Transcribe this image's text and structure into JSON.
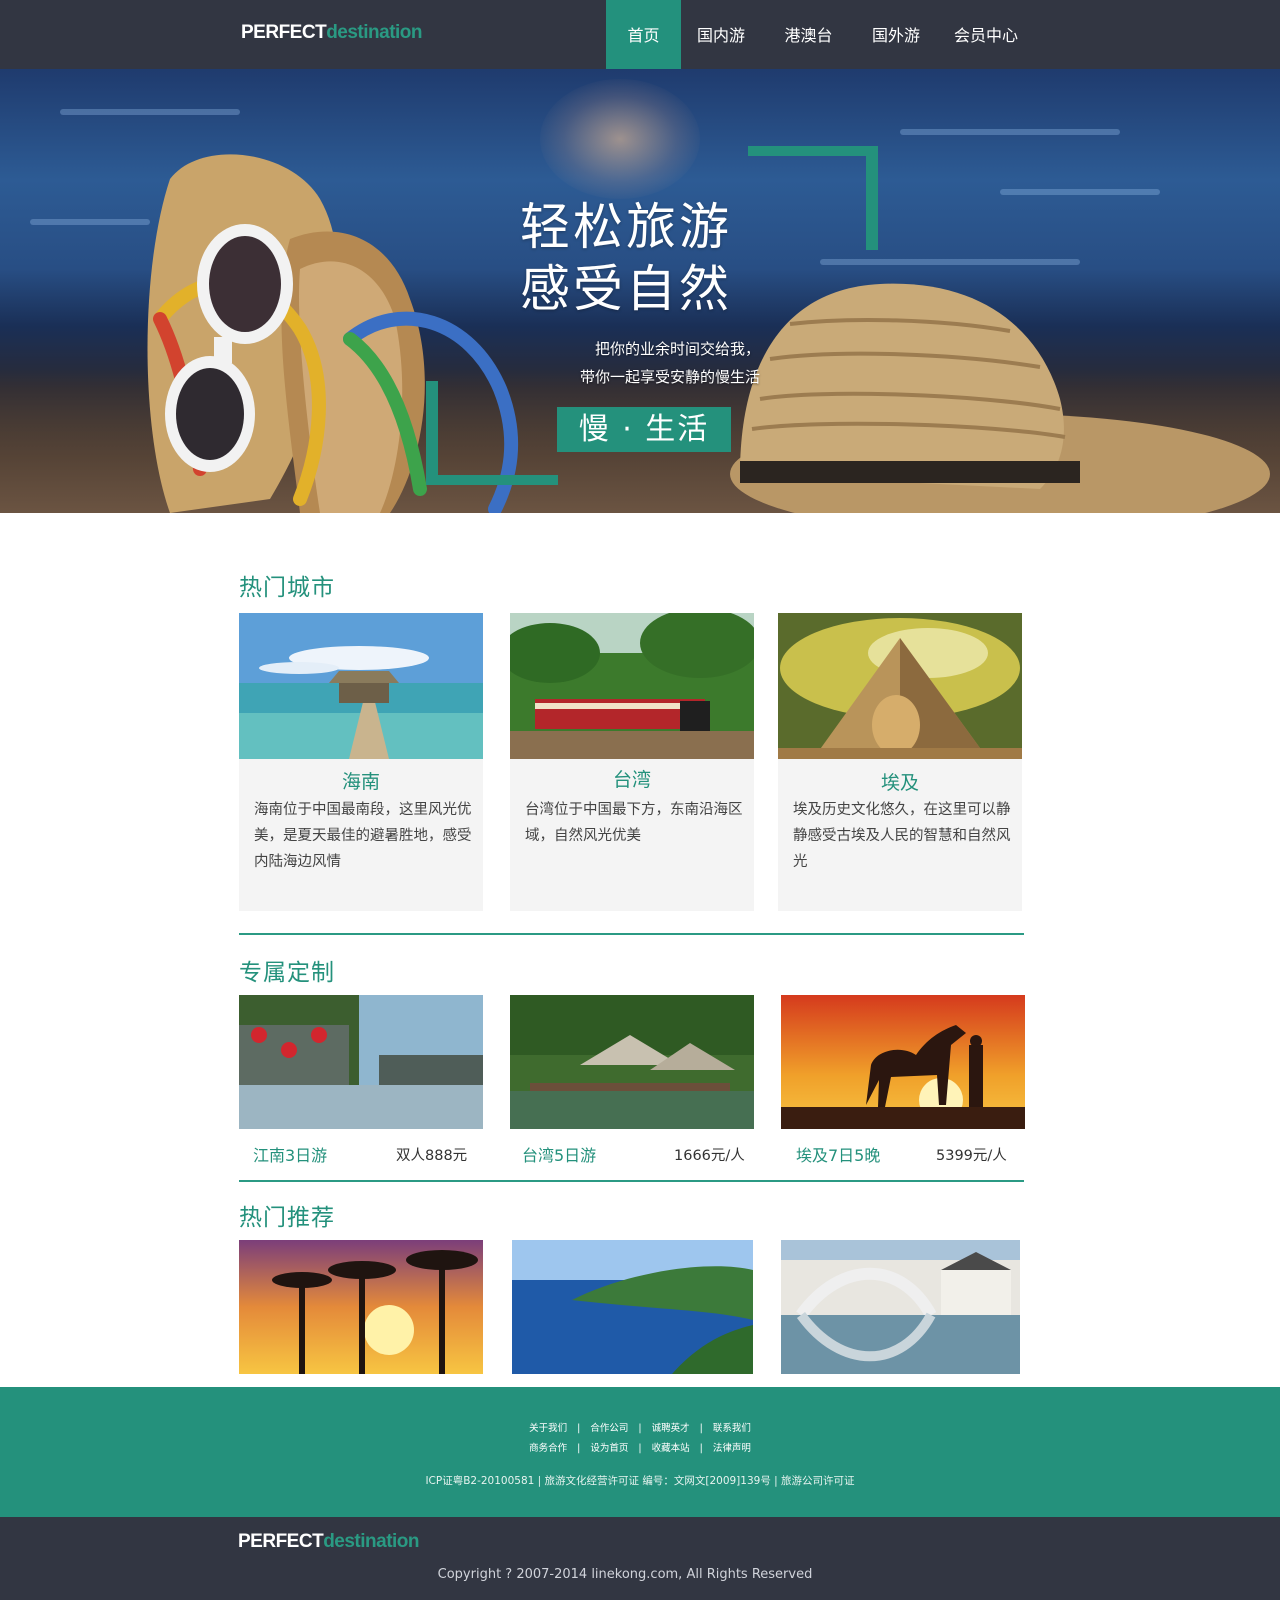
{
  "logo": {
    "part1": "PERFECT",
    "part2": "destination"
  },
  "nav": [
    {
      "label": "首页",
      "active": true
    },
    {
      "label": "国内游"
    },
    {
      "label": "港澳台"
    },
    {
      "label": "国外游"
    },
    {
      "label": "会员中心"
    }
  ],
  "hero": {
    "title_line1": "轻松旅游",
    "title_line2": "感受自然",
    "sub_line1": "把你的业余时间交给我，",
    "sub_line2": "带你一起享受安静的慢生活",
    "button": "慢 · 生活"
  },
  "sections": {
    "hot_cities": "热门城市",
    "custom": "专属定制",
    "recommend": "热门推荐"
  },
  "cities": [
    {
      "name": "海南",
      "desc": "海南位于中国最南段，这里风光优美，是夏天最佳的避暑胜地，感受内陆海边风情"
    },
    {
      "name": "台湾",
      "desc": "台湾位于中国最下方，东南沿海区域，自然风光优美"
    },
    {
      "name": "埃及",
      "desc": "埃及历史文化悠久，在这里可以静静感受古埃及人民的智慧和自然风光"
    }
  ],
  "tours": [
    {
      "name": "江南3日游",
      "price": "双人888元"
    },
    {
      "name": "台湾5日游",
      "price": "1666元/人"
    },
    {
      "name": "埃及7日5晚",
      "price": "5399元/人"
    }
  ],
  "footer": {
    "links_row1": [
      "关于我们",
      "合作公司",
      "诚聘英才",
      "联系我们"
    ],
    "links_row2": [
      "商务合作",
      "设为首页",
      "收藏本站",
      "法律声明"
    ],
    "icp": "ICP证粤B2-20100581 | 旅游文化经营许可证 编号：文网文[2009]139号 | 旅游公司许可证",
    "copyright": "Copyright ? 2007-2014 linekong.com, All Rights Reserved"
  },
  "colors": {
    "accent": "#24917c",
    "header_bg": "#323642",
    "card_bg": "#f4f4f4"
  }
}
